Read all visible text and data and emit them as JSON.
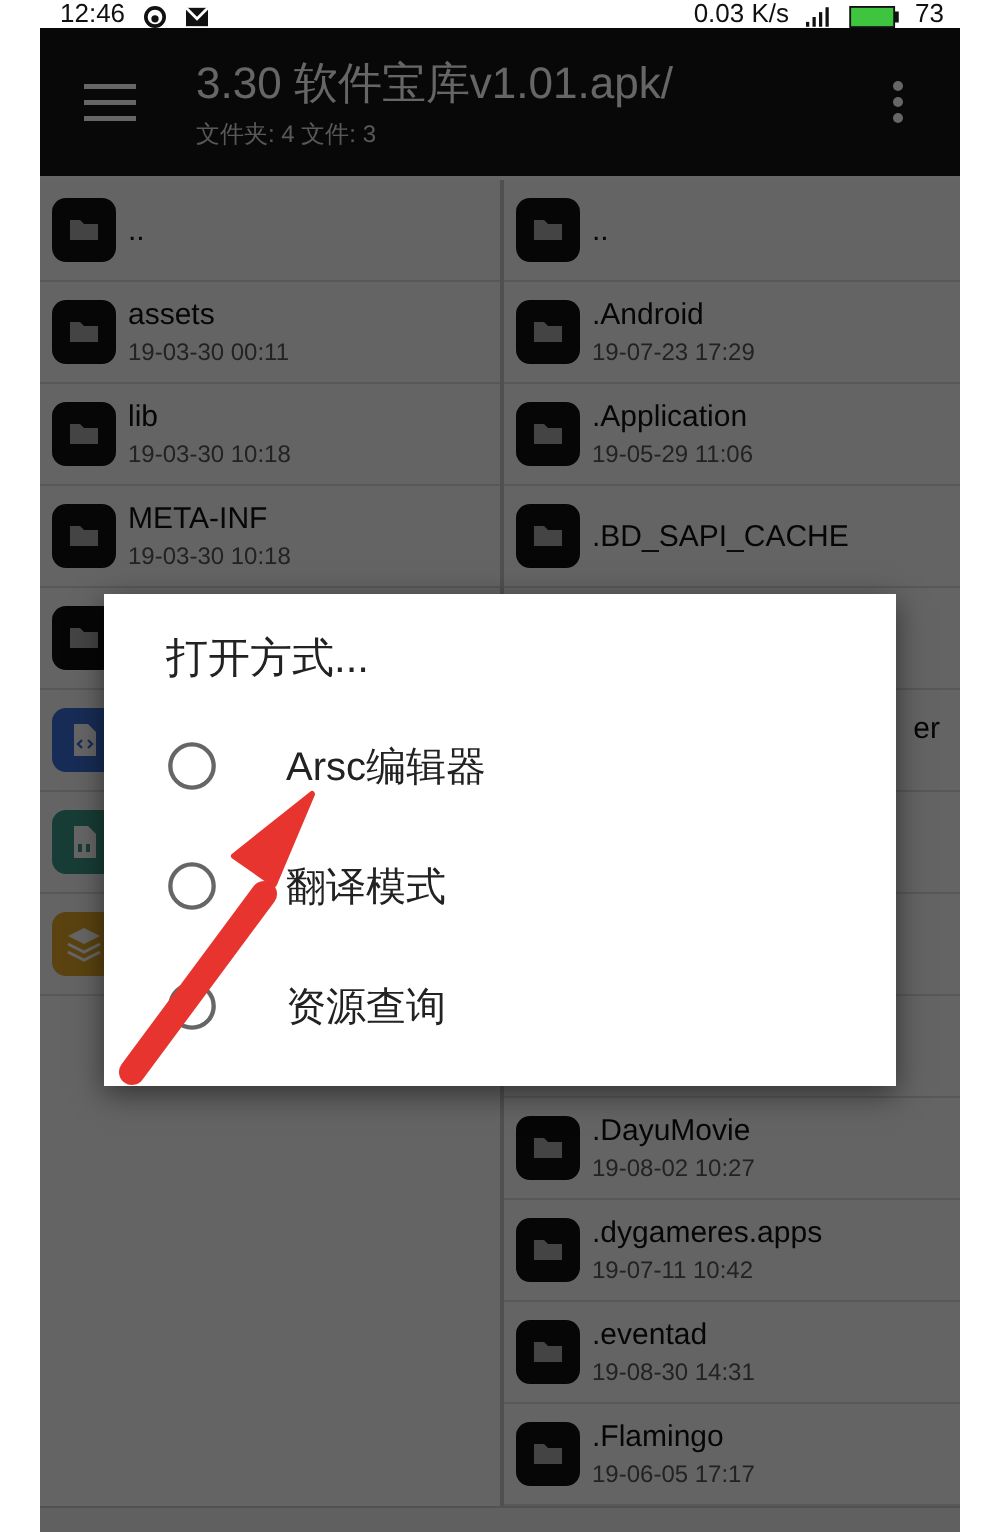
{
  "status_bar": {
    "time": "12:46",
    "speed": "0.03 K/s",
    "battery": "73"
  },
  "app_bar": {
    "title": "3.30 软件宝库v1.01.apk/",
    "subtitle": "文件夹: 4  文件: 3"
  },
  "left_pane": {
    "rows": [
      {
        "kind": "folder",
        "name": ".."
      },
      {
        "kind": "folder",
        "name": "assets",
        "date": "19-03-30 00:11"
      },
      {
        "kind": "folder",
        "name": "lib",
        "date": "19-03-30 10:18"
      },
      {
        "kind": "folder",
        "name": "META-INF",
        "date": "19-03-30 10:18"
      },
      {
        "kind": "folder"
      },
      {
        "kind": "code-file"
      },
      {
        "kind": "binary-file"
      },
      {
        "kind": "layers"
      }
    ]
  },
  "right_pane": {
    "rows": [
      {
        "kind": "folder",
        "name": ".."
      },
      {
        "kind": "folder",
        "name": ".Android",
        "date": "19-07-23 17:29"
      },
      {
        "kind": "folder",
        "name": ".Application",
        "date": "19-05-29 11:06"
      },
      {
        "kind": "folder",
        "name": ".BD_SAPI_CACHE"
      },
      {
        "kind": "covered"
      },
      {
        "kind": "covered",
        "name": "er"
      },
      {
        "kind": "covered"
      },
      {
        "kind": "covered"
      },
      {
        "kind": "covered"
      },
      {
        "kind": "folder",
        "name": ".DayuMovie",
        "date": "19-08-02 10:27"
      },
      {
        "kind": "folder",
        "name": ".dygameres.apps",
        "date": "19-07-11 10:42"
      },
      {
        "kind": "folder",
        "name": ".eventad",
        "date": "19-08-30 14:31"
      },
      {
        "kind": "folder",
        "name": ".Flamingo",
        "date": "19-06-05 17:17"
      }
    ]
  },
  "dialog": {
    "title": "打开方式...",
    "options": [
      {
        "label": "Arsc编辑器",
        "selected": false
      },
      {
        "label": "翻译模式",
        "selected": false
      },
      {
        "label": "资源查询",
        "selected": false
      }
    ]
  }
}
